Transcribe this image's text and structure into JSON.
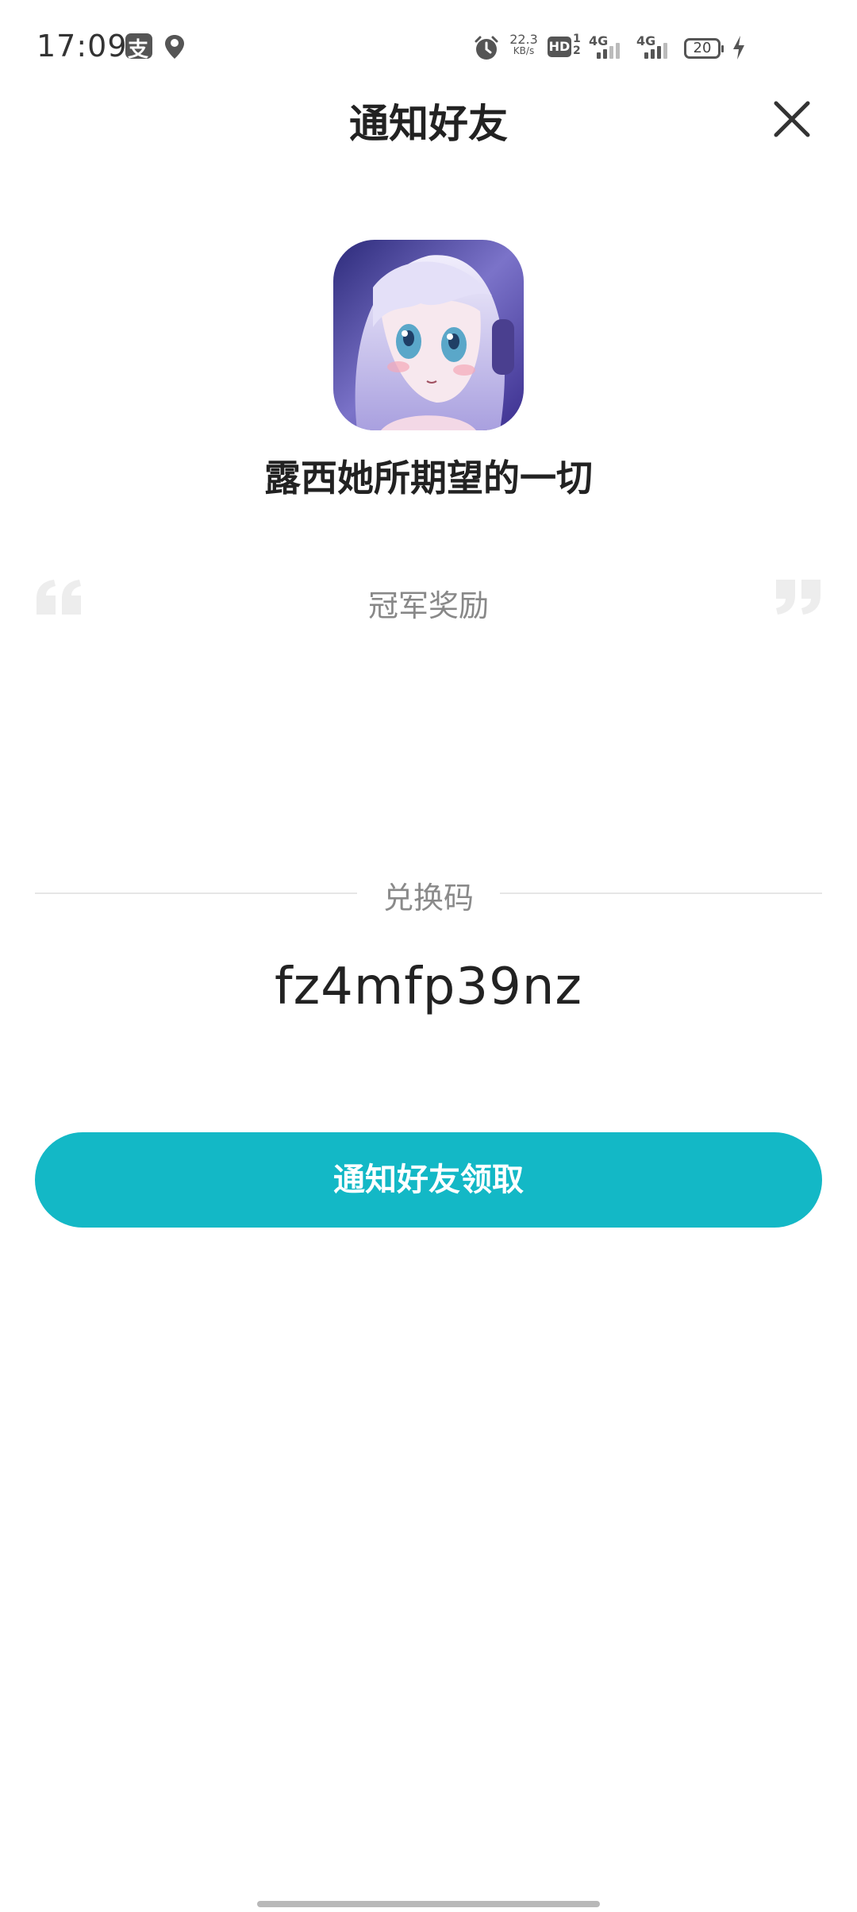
{
  "status_bar": {
    "time": "17:09",
    "net_speed_value": "22.3",
    "net_speed_unit": "KB/s",
    "hd_label": "HD",
    "hd_sim_nums": "1\n2",
    "sig1_label": "4G",
    "sig2_label": "4G",
    "battery_level": "20",
    "icons": [
      "alipay-icon",
      "map-pin-icon",
      "alarm-icon",
      "bolt-icon"
    ]
  },
  "header": {
    "title": "通知好友",
    "close_icon": "close-icon"
  },
  "game": {
    "name": "露西她所期望的一切"
  },
  "reward": {
    "label": "冠军奖励"
  },
  "code": {
    "label": "兑换码",
    "value": "fz4mfp39nz"
  },
  "actions": {
    "notify_label": "通知好友领取"
  },
  "colors": {
    "accent": "#13b8c6",
    "title_text": "#222222",
    "muted_text": "#888888"
  }
}
